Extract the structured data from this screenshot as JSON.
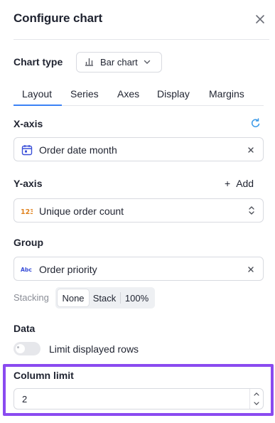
{
  "header": {
    "title": "Configure chart"
  },
  "chart_type": {
    "label": "Chart type",
    "value": "Bar chart"
  },
  "tabs": [
    {
      "label": "Layout",
      "active": true
    },
    {
      "label": "Series",
      "active": false
    },
    {
      "label": "Axes",
      "active": false
    },
    {
      "label": "Display",
      "active": false
    },
    {
      "label": "Margins",
      "active": false
    }
  ],
  "x_axis": {
    "label": "X-axis",
    "value": "Order date month",
    "icon": "calendar-icon"
  },
  "y_axis": {
    "label": "Y-axis",
    "add_label": "Add",
    "value": "Unique order count",
    "badge": "123"
  },
  "group": {
    "label": "Group",
    "value": "Order priority",
    "badge": "Abc"
  },
  "stacking": {
    "label": "Stacking",
    "options": [
      "None",
      "Stack",
      "100%"
    ],
    "selected": "None"
  },
  "data": {
    "label": "Data",
    "limit_rows_label": "Limit displayed rows",
    "limit_rows_enabled": false
  },
  "column_limit": {
    "label": "Column limit",
    "value": "2"
  },
  "colors": {
    "accent": "#3b82f6",
    "highlight": "#8a4af0",
    "number_badge": "#e0831f",
    "text_badge": "#3a4fd8"
  }
}
